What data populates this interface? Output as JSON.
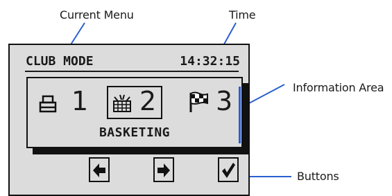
{
  "callouts": {
    "current_menu": "Current Menu",
    "time": "Time",
    "information_area": "Information Area",
    "buttons": "Buttons"
  },
  "screen": {
    "menu_title": "CLUB MODE",
    "clock": "14:32:15",
    "info": {
      "items": [
        {
          "number": "1",
          "icon": "printer-icon",
          "selected": false
        },
        {
          "number": "2",
          "icon": "basket-icon",
          "selected": true
        },
        {
          "number": "3",
          "icon": "flag-icon",
          "selected": false
        }
      ],
      "status_text": "BASKETING"
    },
    "buttons": [
      {
        "icon": "arrow-left-icon"
      },
      {
        "icon": "arrow-right-icon"
      },
      {
        "icon": "checkmark-icon"
      }
    ]
  },
  "colors": {
    "screen_bg": "#dcdcdc",
    "ink": "#111111",
    "leader_line": "#2b5fcf"
  }
}
